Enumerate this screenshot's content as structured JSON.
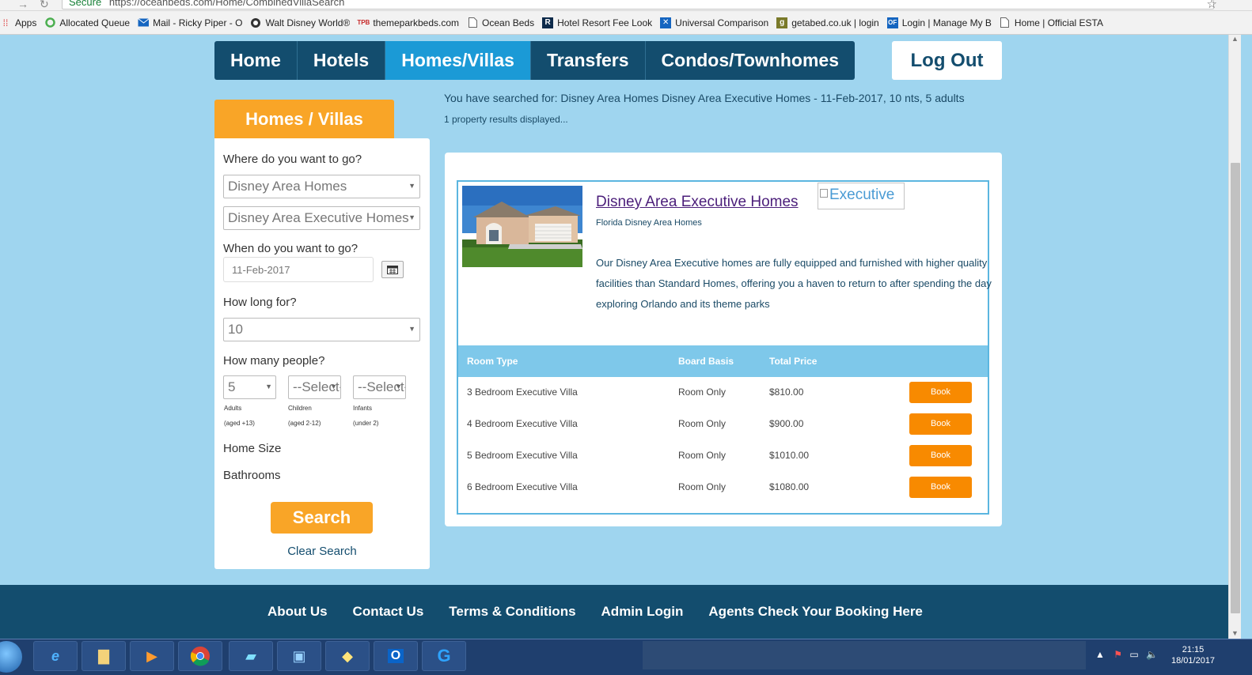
{
  "browser": {
    "secure_label": "Secure",
    "url": "https://oceanbeds.com/Home/CombinedVillaSearch",
    "bookmarks": [
      {
        "label": "Apps",
        "icon": "apps-icon"
      },
      {
        "label": "Allocated Queue",
        "icon": "circle-icon"
      },
      {
        "label": "Mail - Ricky Piper - O",
        "icon": "mail-icon"
      },
      {
        "label": "Walt Disney World®",
        "icon": "disney-icon"
      },
      {
        "label": "themeparkbeds.com",
        "icon": "tpb-icon"
      },
      {
        "label": "Ocean Beds",
        "icon": "page-icon"
      },
      {
        "label": "Hotel Resort Fee Look",
        "icon": "r-icon"
      },
      {
        "label": "Universal Comparison",
        "icon": "tools-icon"
      },
      {
        "label": "getabed.co.uk | login",
        "icon": "g-icon"
      },
      {
        "label": "Login | Manage My B",
        "icon": "of-icon"
      },
      {
        "label": "Home | Official ESTA",
        "icon": "page-icon"
      }
    ]
  },
  "nav": {
    "items": [
      {
        "label": "Home",
        "active": false
      },
      {
        "label": "Hotels",
        "active": false
      },
      {
        "label": "Homes/Villas",
        "active": true
      },
      {
        "label": "Transfers",
        "active": false
      },
      {
        "label": "Condos/Townhomes",
        "active": false
      }
    ],
    "logout_label": "Log Out",
    "active_color": "#1b9ad6",
    "bar_color": "#134d6e"
  },
  "search_summary": {
    "text": "You have searched for: Disney Area Homes Disney Area Executive Homes - 11-Feb-2017, 10 nts, 5 adults",
    "results_text": "1 property results displayed..."
  },
  "sidebar": {
    "tab_label": "Homes / Villas",
    "where_label": "Where do you want to go?",
    "destination": "Disney Area Homes",
    "subdestination": "Disney Area Executive Homes",
    "when_label": "When do you want to go?",
    "date_value": "11-Feb-2017",
    "howlong_label": "How long for?",
    "nights": "10",
    "people_label": "How many people?",
    "adults": "5",
    "children": "--Select--",
    "infants": "--Select--",
    "adults_label": "Adults",
    "adults_age": "(aged +13)",
    "children_label": "Children",
    "children_age": "(aged 2-12)",
    "infants_label": "Infants",
    "infants_age": "(under 2)",
    "home_size_label": "Home Size",
    "bathrooms_label": "Bathrooms",
    "search_label": "Search",
    "clear_label": "Clear Search",
    "accent_color": "#f9a527"
  },
  "property": {
    "title": "Disney Area Executive Homes",
    "broken_image_alt": "Executive",
    "subtitle": "Florida Disney Area Homes",
    "description": "Our Disney Area Executive homes are fully equipped and furnished with higher quality facilities than Standard Homes, offering you a haven to return to after spending the day exploring Orlando and its theme parks",
    "table": {
      "headers": [
        "Room Type",
        "Board Basis",
        "Total Price"
      ],
      "rows": [
        {
          "room": "3 Bedroom Executive Villa",
          "board": "Room Only",
          "price": "$810.00",
          "action": "Book"
        },
        {
          "room": "4 Bedroom Executive Villa",
          "board": "Room Only",
          "price": "$900.00",
          "action": "Book"
        },
        {
          "room": "5 Bedroom Executive Villa",
          "board": "Room Only",
          "price": "$1010.00",
          "action": "Book"
        },
        {
          "room": "6 Bedroom Executive Villa",
          "board": "Room Only",
          "price": "$1080.00",
          "action": "Book"
        }
      ]
    },
    "book_color": "#f88a00"
  },
  "footer": {
    "links": [
      "About Us",
      "Contact Us",
      "Terms & Conditions",
      "Admin Login",
      "Agents Check Your Booking Here"
    ]
  },
  "taskbar": {
    "time": "21:15",
    "date": "18/01/2017"
  }
}
